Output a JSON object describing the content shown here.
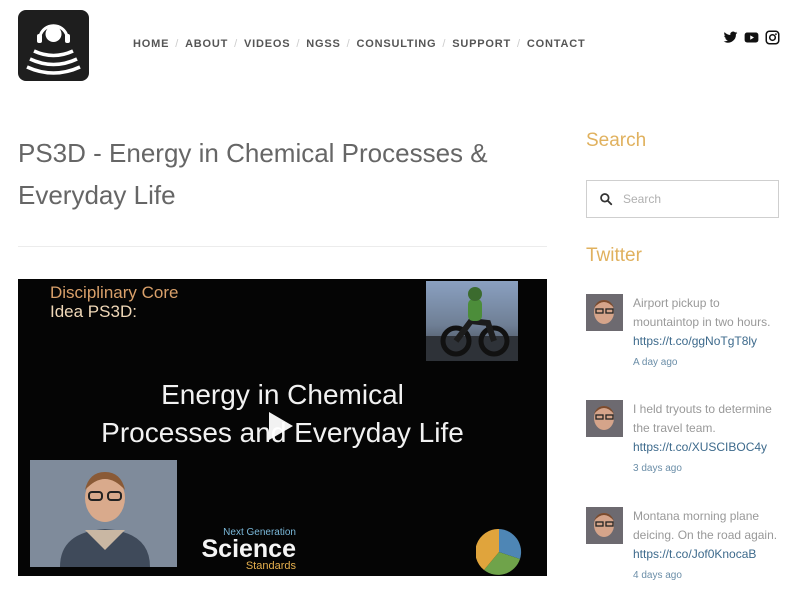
{
  "header": {
    "nav": [
      "HOME",
      "ABOUT",
      "VIDEOS",
      "NGSS",
      "CONSULTING",
      "SUPPORT",
      "CONTACT"
    ],
    "social_icons": [
      "twitter-icon",
      "youtube-icon",
      "instagram-icon"
    ]
  },
  "main": {
    "title_line1": "PS3D - Energy in Chemical Processes &",
    "title_line2": "Everyday Life",
    "video": {
      "dci_line1": "Disciplinary Core",
      "dci_line2": "Idea PS3D:",
      "headline_line1": "Energy in Chemical",
      "headline_line2": "Processes and Everyday Life",
      "ngss_small": "Next Generation",
      "ngss_big": "Science",
      "ngss_std": "Standards"
    }
  },
  "sidebar": {
    "search_heading": "Search",
    "search_placeholder": "Search",
    "twitter_heading": "Twitter",
    "tweets": [
      {
        "text": "Airport pickup to mountaintop in two hours.",
        "link": "https://t.co/ggNoTgT8ly",
        "time": "A day ago"
      },
      {
        "text": "I held tryouts to determine the travel team.",
        "link": "https://t.co/XUSCIBOC4y",
        "time": "3 days ago"
      },
      {
        "text": "Montana morning plane deicing. On the road again.",
        "link": "https://t.co/Jof0KnocaB",
        "time": "4 days ago"
      }
    ]
  },
  "colors": {
    "accent": "#e0b15e",
    "link": "#3d6a8c",
    "video_bg": "#050505"
  }
}
